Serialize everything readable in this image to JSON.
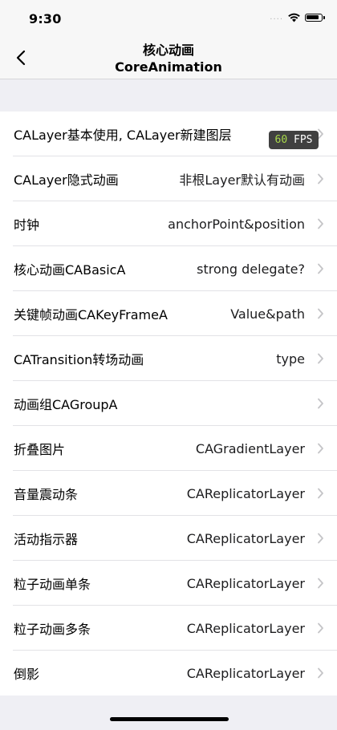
{
  "status_bar": {
    "time": "9:30",
    "signal_dots": "....",
    "icons": [
      "wifi-icon",
      "battery-icon"
    ]
  },
  "nav": {
    "title": "核心动画",
    "subtitle": "CoreAnimation",
    "back_icon": "chevron-left-icon"
  },
  "fps_overlay": {
    "value": "60",
    "unit": "FPS"
  },
  "rows": [
    {
      "title": "CALayer基本使用, CALayer新建图层",
      "detail": ""
    },
    {
      "title": "CALayer隐式动画",
      "detail": "非根Layer默认有动画"
    },
    {
      "title": "时钟",
      "detail": "anchorPoint&position"
    },
    {
      "title": "核心动画CABasicA",
      "detail": "strong delegate?"
    },
    {
      "title": "关键帧动画CAKeyFrameA",
      "detail": "Value&path"
    },
    {
      "title": "CATransition转场动画",
      "detail": "type"
    },
    {
      "title": "动画组CAGroupA",
      "detail": ""
    },
    {
      "title": "折叠图片",
      "detail": "CAGradientLayer"
    },
    {
      "title": "音量震动条",
      "detail": "CAReplicatorLayer"
    },
    {
      "title": "活动指示器",
      "detail": "CAReplicatorLayer"
    },
    {
      "title": "粒子动画单条",
      "detail": "CAReplicatorLayer"
    },
    {
      "title": "粒子动画多条",
      "detail": "CAReplicatorLayer"
    },
    {
      "title": "倒影",
      "detail": "CAReplicatorLayer"
    }
  ],
  "colors": {
    "background": "#efeff4",
    "cell": "#ffffff",
    "separator": "#e2e2e6",
    "chevron": "#c4c4c7",
    "fps_number": "#a8d94a"
  }
}
